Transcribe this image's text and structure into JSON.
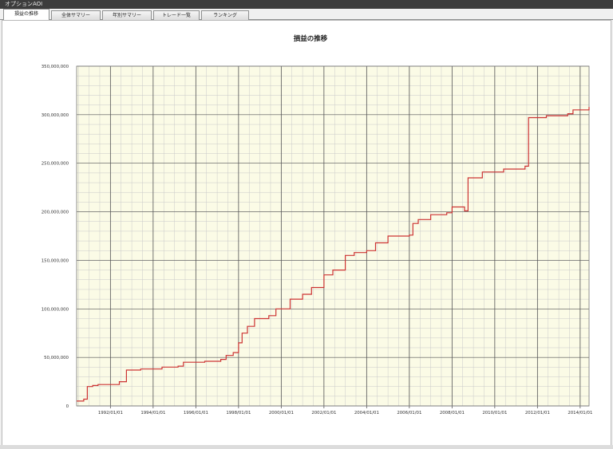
{
  "window": {
    "title": "オプションAOI"
  },
  "tabs": [
    {
      "label": "損益の推移",
      "active": true
    },
    {
      "label": "全体サマリー",
      "active": false
    },
    {
      "label": "年別サマリー",
      "active": false
    },
    {
      "label": "トレード一覧",
      "active": false
    },
    {
      "label": "ランキング",
      "active": false
    }
  ],
  "colors": {
    "plot_background": "#fbfbe6",
    "line": "#cc3333",
    "major_grid": "#555555",
    "minor_grid": "#c9c9c9"
  },
  "chart_data": {
    "type": "line",
    "title": "損益の推移",
    "xlabel": "",
    "ylabel": "",
    "x_range": [
      "1990/06/01",
      "2014/06/01"
    ],
    "ylim": [
      0,
      350000000
    ],
    "y_ticks": [
      "0",
      "50,000,000",
      "100,000,000",
      "150,000,000",
      "200,000,000",
      "250,000,000",
      "300,000,000",
      "350,000,000"
    ],
    "x_ticks": [
      "1992/01/01",
      "1994/01/01",
      "1996/01/01",
      "1998/01/01",
      "2000/01/01",
      "2002/01/01",
      "2004/01/01",
      "2006/01/01",
      "2008/01/01",
      "2010/01/01",
      "2012/01/01",
      "2014/01/01"
    ],
    "grid": true,
    "series": [
      {
        "points": [
          [
            "1990/06/01",
            5000000
          ],
          [
            "1990/10/01",
            7000000
          ],
          [
            "1990/12/01",
            20000000
          ],
          [
            "1991/03/01",
            21000000
          ],
          [
            "1991/06/01",
            22000000
          ],
          [
            "1992/06/01",
            25000000
          ],
          [
            "1992/10/01",
            37000000
          ],
          [
            "1993/06/01",
            38000000
          ],
          [
            "1994/06/01",
            40000000
          ],
          [
            "1995/03/01",
            41000000
          ],
          [
            "1995/06/01",
            45000000
          ],
          [
            "1996/06/01",
            46000000
          ],
          [
            "1997/03/01",
            48000000
          ],
          [
            "1997/06/01",
            52000000
          ],
          [
            "1997/10/01",
            55000000
          ],
          [
            "1998/01/01",
            65000000
          ],
          [
            "1998/03/01",
            75000000
          ],
          [
            "1998/06/01",
            82000000
          ],
          [
            "1998/10/01",
            90000000
          ],
          [
            "1999/06/01",
            93000000
          ],
          [
            "1999/10/01",
            100000000
          ],
          [
            "2000/06/01",
            110000000
          ],
          [
            "2001/01/01",
            115000000
          ],
          [
            "2001/06/01",
            122000000
          ],
          [
            "2002/01/01",
            135000000
          ],
          [
            "2002/06/01",
            140000000
          ],
          [
            "2003/01/01",
            155000000
          ],
          [
            "2003/06/01",
            158000000
          ],
          [
            "2004/01/01",
            160000000
          ],
          [
            "2004/06/01",
            168000000
          ],
          [
            "2005/01/01",
            175000000
          ],
          [
            "2006/01/01",
            176000000
          ],
          [
            "2006/03/01",
            188000000
          ],
          [
            "2006/06/01",
            192000000
          ],
          [
            "2007/01/01",
            197000000
          ],
          [
            "2007/10/01",
            199000000
          ],
          [
            "2008/01/01",
            205000000
          ],
          [
            "2008/06/01",
            205000000
          ],
          [
            "2008/08/01",
            201000000
          ],
          [
            "2008/10/01",
            235000000
          ],
          [
            "2009/06/01",
            241000000
          ],
          [
            "2010/06/01",
            244000000
          ],
          [
            "2011/06/01",
            247000000
          ],
          [
            "2011/08/01",
            297000000
          ],
          [
            "2012/06/01",
            299000000
          ],
          [
            "2013/06/01",
            301000000
          ],
          [
            "2013/09/01",
            305000000
          ],
          [
            "2014/06/01",
            308000000
          ]
        ]
      }
    ]
  }
}
